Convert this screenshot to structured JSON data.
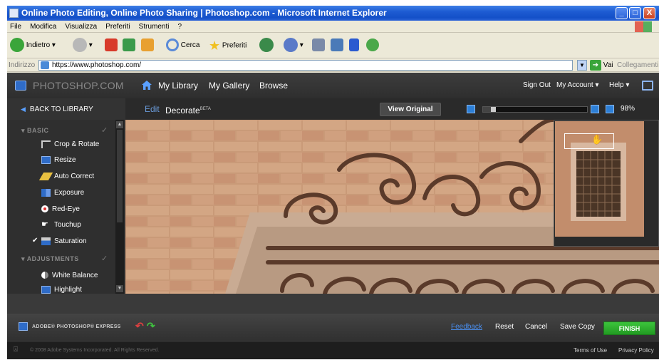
{
  "window": {
    "title": "Online Photo Editing, Online Photo Sharing | Photoshop.com - Microsoft Internet Explorer",
    "min_glyph": "_",
    "max_glyph": "□",
    "close_glyph": "X"
  },
  "menu": [
    "File",
    "Modifica",
    "Visualizza",
    "Preferiti",
    "Strumenti",
    "?"
  ],
  "toolbar": {
    "back_label": "Indietro",
    "search_label": "Cerca",
    "favorites_label": "Preferiti"
  },
  "address": {
    "label": "Indirizzo",
    "url": "https://www.photoshop.com/",
    "go_label": "Vai",
    "links_label": "Collegamenti"
  },
  "app": {
    "brand": "PHOTOSHOP.COM",
    "nav": [
      "My Library",
      "My Gallery",
      "Browse"
    ],
    "account": {
      "sign_out": "Sign Out",
      "my_account": "My Account",
      "help": "Help"
    },
    "back_to_library": "BACK TO LIBRARY",
    "tabs": {
      "edit": "Edit",
      "decorate": "Decorate",
      "beta": "BETA"
    },
    "view_original": "View Original",
    "zoom": {
      "percent": "98%",
      "slider_level": 0.12
    },
    "sections": {
      "basic": "BASIC",
      "adjustments": "ADJUSTMENTS"
    },
    "tools_basic": [
      "Crop & Rotate",
      "Resize",
      "Auto Correct",
      "Exposure",
      "Red-Eye",
      "Touchup",
      "Saturation"
    ],
    "tools_adjustments": [
      "White Balance",
      "Highlight"
    ],
    "bottom": {
      "express": "ADOBE® PHOTOSHOP® EXPRESS",
      "feedback": "Feedback",
      "reset": "Reset",
      "cancel": "Cancel",
      "save_copy": "Save Copy",
      "finish": "FINISH"
    },
    "footer": {
      "copyright": "© 2008 Adobe Systems Incorporated. All Rights Reserved.",
      "terms": "Terms of Use",
      "privacy": "Privacy Policy"
    }
  },
  "colors": {
    "accent": "#2f6cc8",
    "finish": "#2aa52a",
    "brick": "#c69876"
  }
}
